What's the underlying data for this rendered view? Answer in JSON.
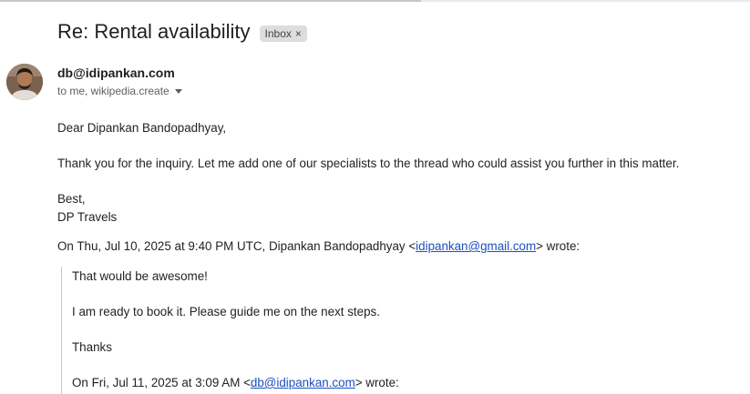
{
  "email": {
    "subject": "Re: Rental availability",
    "label": "Inbox",
    "label_close": "×",
    "sender": "db@idipankan.com",
    "recipients": "to me, wikipedia.create",
    "greeting": "Dear Dipankan Bandopadhyay,",
    "body_line": "Thank you for the inquiry. Let me add one of our specialists to the thread who could assist you further in this matter.",
    "signoff": "Best,",
    "signature": "DP Travels",
    "quote_header": {
      "prefix": "On Thu, Jul 10, 2025 at 9:40 PM UTC, Dipankan Bandopadhyay <",
      "email": "idipankan@gmail.com",
      "suffix": "> wrote:"
    },
    "quoted": {
      "line1": "That would be awesome!",
      "line2": "I am ready to book it. Please guide me on the next steps.",
      "line3": "Thanks",
      "nested_header": {
        "prefix": "On Fri, Jul 11, 2025 at 3:09 AM <",
        "email": "db@idipankan.com",
        "suffix": "> wrote:"
      }
    }
  },
  "colors": {
    "link": "#1a4fc1",
    "chip_bg": "#dddddd"
  }
}
